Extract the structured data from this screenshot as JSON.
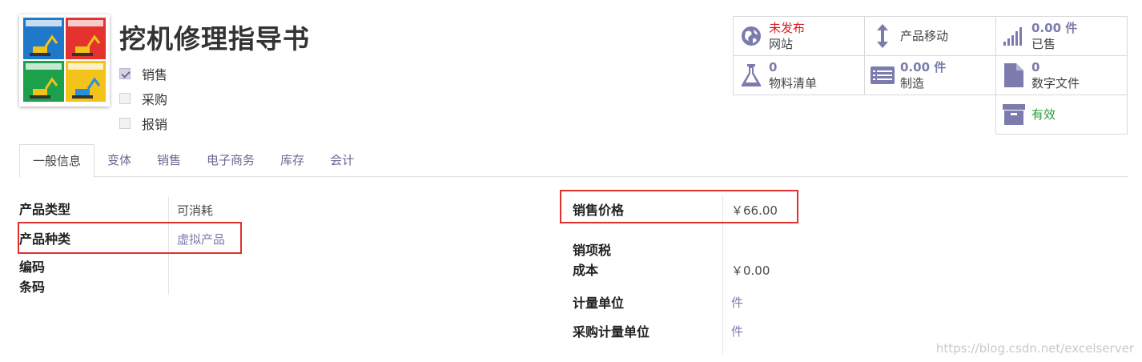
{
  "product": {
    "title": "挖机修理指导书",
    "image_alt": "excavator-manual-thumbnail"
  },
  "checkboxes": [
    {
      "label": "销售",
      "checked": true
    },
    {
      "label": "采购",
      "checked": false
    },
    {
      "label": "报销",
      "checked": false
    }
  ],
  "smart_buttons": {
    "website": {
      "value": "未发布",
      "label": "网站",
      "icon": "globe-icon"
    },
    "moves": {
      "label": "产品移动",
      "icon": "updown-arrow-icon"
    },
    "sold": {
      "value": "0.00 件",
      "label": "已售",
      "icon": "signal-bars-icon"
    },
    "bom": {
      "value": "0",
      "label": "物料清单",
      "icon": "flask-icon"
    },
    "manufacture": {
      "value": "0.00 件",
      "label": "制造",
      "icon": "list-card-icon"
    },
    "digital": {
      "value": "0",
      "label": "数字文件",
      "icon": "file-icon"
    },
    "active": {
      "label": "有效",
      "icon": "archive-icon"
    }
  },
  "tabs": [
    "一般信息",
    "变体",
    "销售",
    "电子商务",
    "库存",
    "会计"
  ],
  "left_fields": {
    "type_label": "产品类型",
    "type_value": "可消耗",
    "category_label": "产品种类",
    "category_value": "虚拟产品",
    "code_label": "编码",
    "barcode_label": "条码"
  },
  "right_fields": {
    "price_label": "销售价格",
    "price_value": "￥66.00",
    "tax_label": "销项税",
    "cost_label": "成本",
    "cost_value": "￥0.00",
    "uom_label": "计量单位",
    "uom_value": "件",
    "po_uom_label": "采购计量单位",
    "po_uom_value": "件"
  },
  "watermark": "https://blog.csdn.net/excelserver",
  "colors": {
    "accent": "#7c7bad",
    "highlight_box": "#e0302b",
    "unpublished": "#dc1b1b",
    "active": "#2a9b3b"
  }
}
